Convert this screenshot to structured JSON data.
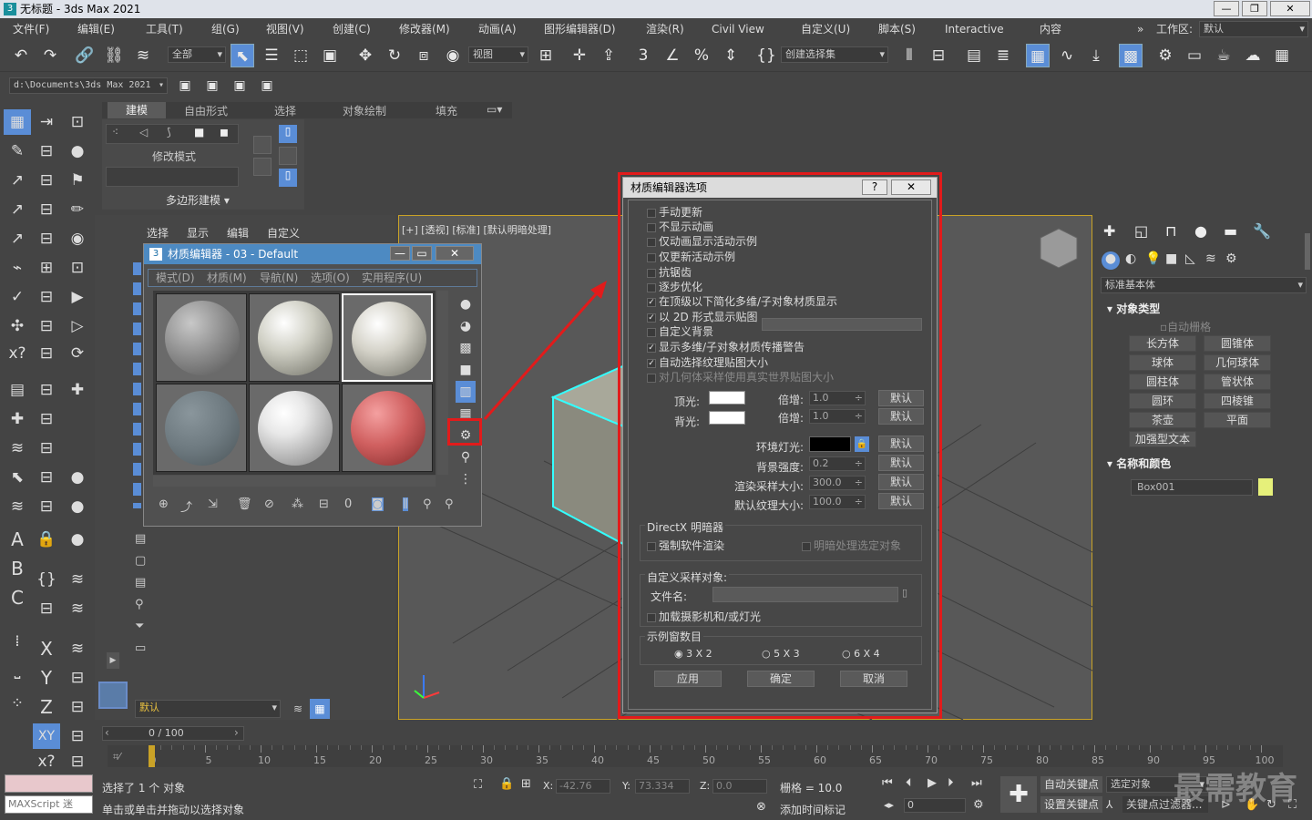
{
  "app": {
    "title": "无标题 - 3ds Max 2021"
  },
  "window_buttons": {
    "min": "—",
    "max": "❐",
    "close": "✕"
  },
  "menubar": {
    "items": [
      "文件(F)",
      "编辑(E)",
      "工具(T)",
      "组(G)",
      "视图(V)",
      "创建(C)",
      "修改器(M)",
      "动画(A)",
      "图形编辑器(D)",
      "渲染(R)",
      "Civil View",
      "自定义(U)",
      "脚本(S)",
      "Interactive",
      "内容"
    ],
    "workspace_label": "工作区:",
    "workspace_value": "默认"
  },
  "toolbar": {
    "selection_filter": "全部",
    "ref_coord": "视图",
    "named_selection": "创建选择集",
    "path": "d:\\Documents\\3ds Max 2021"
  },
  "ribbon": {
    "tabs": [
      "建模",
      "自由形式",
      "选择",
      "对象绘制",
      "填充"
    ],
    "active_tab": "建模",
    "modify_mode": "修改模式",
    "poly_modeling": "多边形建模 ▾"
  },
  "scene_explorer_menu": [
    "选择",
    "显示",
    "编辑",
    "自定义"
  ],
  "viewport": {
    "label": "[+] [透视] [标准] [默认明暗处理]"
  },
  "material_editor": {
    "title": "材质编辑器 - 03 - Default",
    "menu": [
      "模式(D)",
      "材质(M)",
      "导航(N)",
      "选项(O)",
      "实用程序(U)"
    ],
    "slot_colors": [
      "#8a8a8a",
      "#cfcfc4",
      "#d4d2c8",
      "#6e7a80",
      "#e8e8e8",
      "#d06060"
    ]
  },
  "options_dialog": {
    "title": "材质编辑器选项",
    "help": "?",
    "close": "✕",
    "checkboxes": [
      {
        "label": "手动更新",
        "checked": false,
        "dim": false
      },
      {
        "label": "不显示动画",
        "checked": false,
        "dim": false
      },
      {
        "label": "仅动画显示活动示例",
        "checked": false,
        "dim": false
      },
      {
        "label": "仅更新活动示例",
        "checked": false,
        "dim": false
      },
      {
        "label": "抗锯齿",
        "checked": false,
        "dim": false
      },
      {
        "label": "逐步优化",
        "checked": false,
        "dim": false
      },
      {
        "label": "在顶级以下简化多维/子对象材质显示",
        "checked": true,
        "dim": false
      },
      {
        "label": "以 2D 形式显示贴图",
        "checked": true,
        "dim": false
      },
      {
        "label": "自定义背景",
        "checked": false,
        "dim": false
      },
      {
        "label": "显示多维/子对象材质传播警告",
        "checked": true,
        "dim": false
      },
      {
        "label": "自动选择纹理贴图大小",
        "checked": true,
        "dim": false
      },
      {
        "label": "对几何体采样使用真实世界贴图大小",
        "checked": false,
        "dim": true
      }
    ],
    "top_light": "顶光:",
    "back_light": "背光:",
    "multiplier": "倍增:",
    "mult_top": "1.0",
    "mult_back": "1.0",
    "default_btn": "默认",
    "ambient_light": "环境灯光:",
    "bg_intensity": "背景强度:",
    "bg_intensity_val": "0.2",
    "render_sample_size": "渲染采样大小:",
    "render_sample_val": "300.0",
    "default_tex_size": "默认纹理大小:",
    "default_tex_val": "100.0",
    "directx_group": "DirectX 明暗器",
    "force_software": "强制软件渲染",
    "shade_selected": "明暗处理选定对象",
    "custom_sample_group": "自定义采样对象:",
    "filename": "文件名:",
    "load_camera": "加载摄影机和/或灯光",
    "slots_group": "示例窗数目",
    "slot_options": [
      "3 X 2",
      "5 X 3",
      "6 X 4"
    ],
    "apply": "应用",
    "ok": "确定",
    "cancel": "取消"
  },
  "command_panel": {
    "category": "标准基本体",
    "object_type": "对象类型",
    "auto_grid": "自动栅格",
    "objects": [
      "长方体",
      "圆锥体",
      "球体",
      "几何球体",
      "圆柱体",
      "管状体",
      "圆环",
      "四棱锥",
      "茶壶",
      "平面",
      "加强型文本"
    ],
    "name_color": "名称和颜色",
    "object_name": "Box001",
    "object_color": "#e6f07a"
  },
  "timeline": {
    "frame": "0 / 100",
    "ticks": [
      "0",
      "5",
      "10",
      "15",
      "20",
      "25",
      "30",
      "35",
      "40",
      "45",
      "50",
      "55",
      "60",
      "65",
      "70",
      "75",
      "80",
      "85",
      "90",
      "95",
      "100"
    ]
  },
  "status": {
    "maxscript": "MAXScript 迷",
    "selected": "选择了 1 个 对象",
    "prompt": "单击或单击并拖动以选择对象",
    "x_label": "X:",
    "x_val": "-42.76",
    "y_label": "Y:",
    "y_val": "73.334",
    "z_label": "Z:",
    "z_val": "0.0",
    "grid": "栅格 = 10.0",
    "add_time_tag": "添加时间标记",
    "auto_key": "自动关键点",
    "selected_obj": "选定对象",
    "set_key": "设置关键点",
    "key_filters": "关键点过滤器...",
    "frame_val": "0",
    "layer_default": "默认"
  },
  "watermark": "最需教育"
}
